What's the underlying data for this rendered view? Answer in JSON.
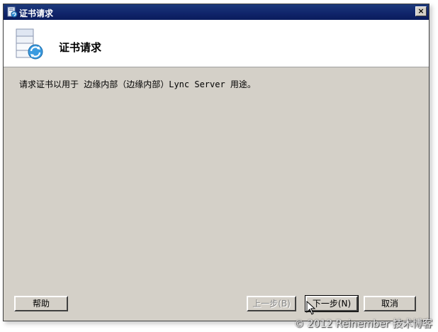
{
  "window": {
    "title": "证书请求",
    "close_label": "×"
  },
  "header": {
    "title": "证书请求"
  },
  "main": {
    "description": "请求证书以用于 边缘内部（边缘内部）Lync Server 用途。"
  },
  "buttons": {
    "help": "帮助",
    "prev": "上一步(B)",
    "next": "下一步(N)",
    "cancel": "取消"
  },
  "watermark": "© 2012 Reinember 技术博客",
  "icons": {
    "title": "certificate-icon",
    "header": "certificate-request-icon",
    "cursor": "mouse-pointer-icon"
  },
  "colors": {
    "titlebar": "#10246a",
    "dialog_bg": "#d4d0c8",
    "header_bg": "#ffffff"
  }
}
